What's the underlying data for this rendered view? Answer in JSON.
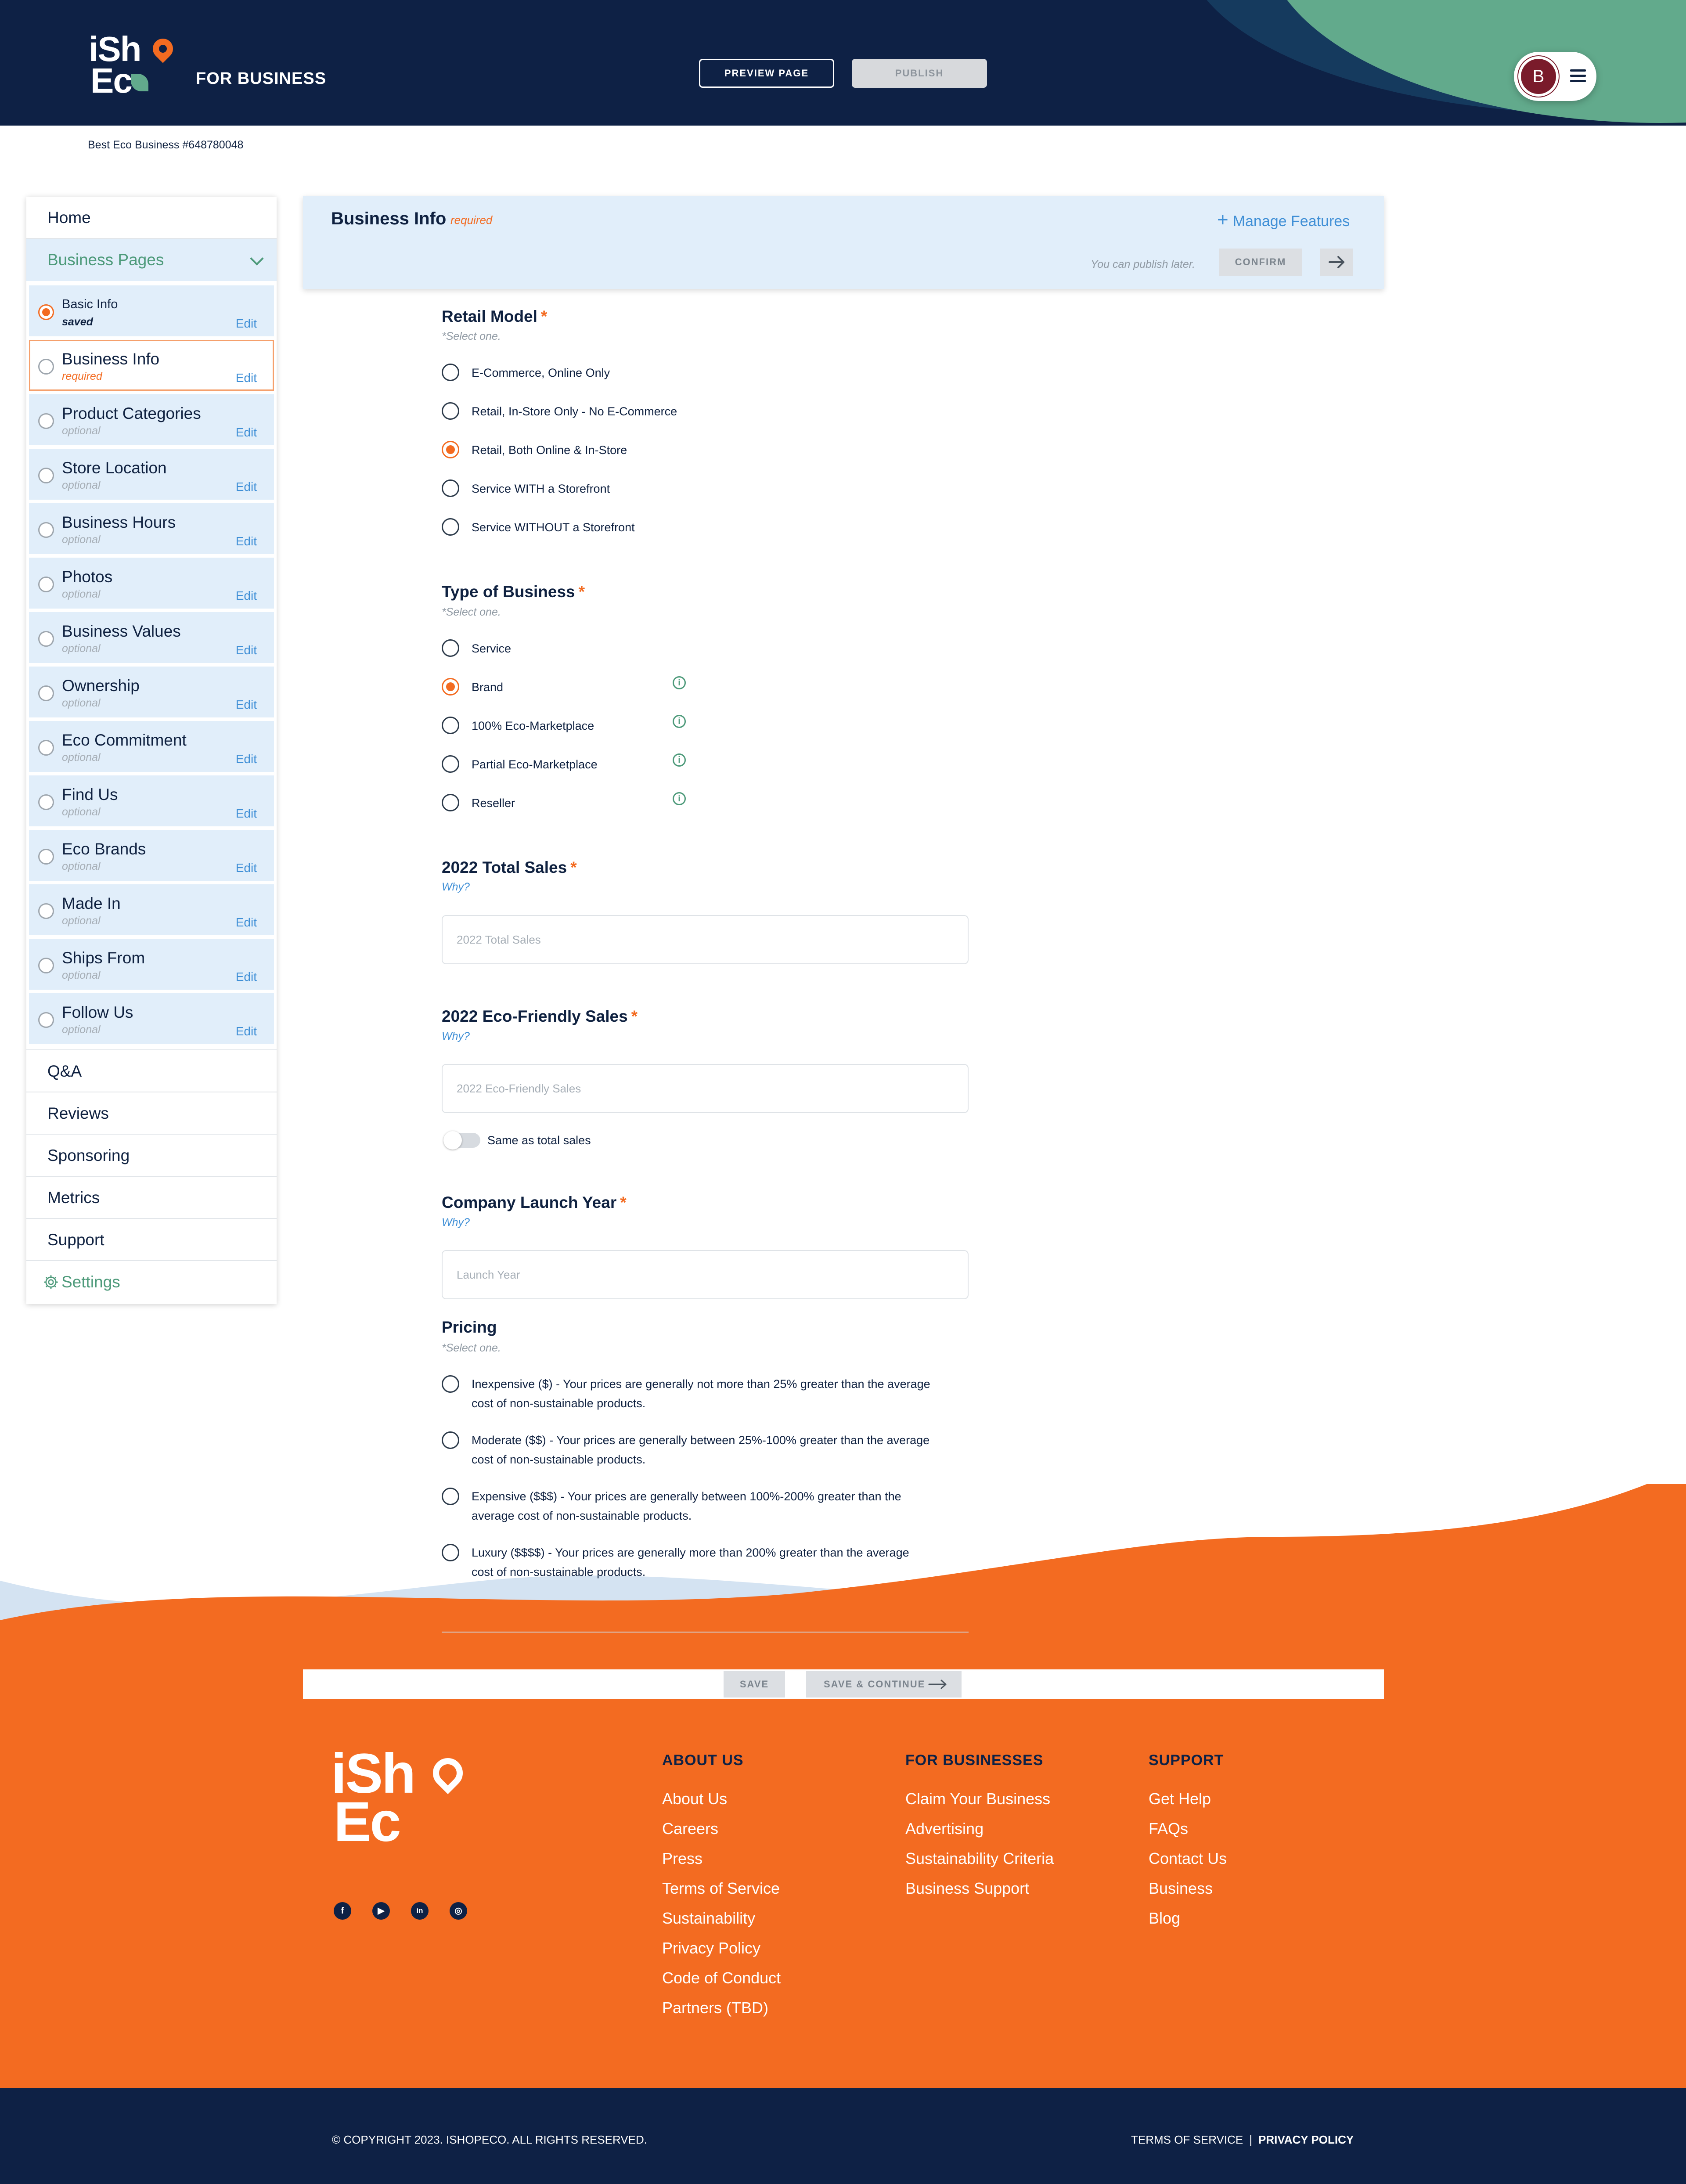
{
  "header": {
    "logo_top": "iSh",
    "logo_bottom": "Ec",
    "for_business": "FOR BUSINESS",
    "preview_label": "PREVIEW PAGE",
    "publish_label": "PUBLISH",
    "avatar_letter": "B"
  },
  "business_id": "Best Eco Business #648780048",
  "sidebar": {
    "home": "Home",
    "section": "Business Pages",
    "items": [
      {
        "label": "Basic Info",
        "status": "saved",
        "edit": "Edit"
      },
      {
        "label": "Business Info",
        "status": "required",
        "edit": "Edit"
      },
      {
        "label": "Product Categories",
        "status": "optional",
        "edit": "Edit"
      },
      {
        "label": "Store Location",
        "status": "optional",
        "edit": "Edit"
      },
      {
        "label": "Business Hours",
        "status": "optional",
        "edit": "Edit"
      },
      {
        "label": "Photos",
        "status": "optional",
        "edit": "Edit"
      },
      {
        "label": "Business Values",
        "status": "optional",
        "edit": "Edit"
      },
      {
        "label": "Ownership",
        "status": "optional",
        "edit": "Edit"
      },
      {
        "label": "Eco Commitment",
        "status": "optional",
        "edit": "Edit"
      },
      {
        "label": "Find Us",
        "status": "optional",
        "edit": "Edit"
      },
      {
        "label": "Eco Brands",
        "status": "optional",
        "edit": "Edit"
      },
      {
        "label": "Made In",
        "status": "optional",
        "edit": "Edit"
      },
      {
        "label": "Ships From",
        "status": "optional",
        "edit": "Edit"
      },
      {
        "label": "Follow Us",
        "status": "optional",
        "edit": "Edit"
      }
    ],
    "links": [
      "Q&A",
      "Reviews",
      "Sponsoring",
      "Metrics",
      "Support"
    ],
    "settings": "Settings"
  },
  "card": {
    "title": "Business Info",
    "required": "required",
    "manage": "Manage Features",
    "publish_later": "You can publish later.",
    "confirm": "CONFIRM"
  },
  "form": {
    "retail_model": {
      "label": "Retail Model",
      "hint": "*Select one.",
      "options": [
        "E-Commerce, Online Only",
        "Retail, In-Store Only - No E-Commerce",
        "Retail, Both Online & In-Store",
        "Service WITH a Storefront",
        "Service WITHOUT a Storefront"
      ],
      "selected": "Retail, Both Online & In-Store"
    },
    "business_type": {
      "label": "Type of Business",
      "hint": "*Select one.",
      "options": [
        "Service",
        "Brand",
        "100% Eco-Marketplace",
        "Partial Eco-Marketplace",
        "Reseller"
      ],
      "selected": "Brand"
    },
    "total_sales": {
      "label": "2022 Total Sales",
      "why": "Why?",
      "placeholder": "2022 Total Sales"
    },
    "eco_sales": {
      "label": "2022 Eco-Friendly Sales",
      "why": "Why?",
      "placeholder": "2022 Eco-Friendly Sales",
      "toggle_label": "Same as total sales",
      "toggle_on": false
    },
    "launch_year": {
      "label": "Company Launch Year",
      "why": "Why?",
      "placeholder": "Launch Year"
    },
    "pricing": {
      "label": "Pricing",
      "hint": "*Select one.",
      "options": [
        {
          "l1": "Inexpensive ($) - Your prices are generally not more than 25% greater than the average",
          "l2": "cost of non-sustainable products."
        },
        {
          "l1": "Moderate ($$) - Your prices are generally between 25%-100% greater than the average",
          "l2": "cost of non-sustainable products."
        },
        {
          "l1": "Expensive ($$$) - Your prices are generally between 100%-200% greater than the",
          "l2": "average cost of non-sustainable products."
        },
        {
          "l1": "Luxury ($$$$) - Your prices are generally more than 200% greater than the average",
          "l2": "cost of non-sustainable products."
        }
      ]
    },
    "asterisk": "*",
    "save": "SAVE",
    "save_continue": "SAVE & CONTINUE"
  },
  "footer": {
    "logo_top": "iSh",
    "logo_bottom": "Ec",
    "social": [
      "f",
      "▶",
      "in",
      "◎"
    ],
    "about": {
      "title": "ABOUT US",
      "links": [
        "About Us",
        "Careers",
        "Press",
        "Terms of Service",
        "Sustainability",
        "Privacy Policy",
        "Code of Conduct",
        "Partners (TBD)"
      ]
    },
    "business": {
      "title": "FOR BUSINESSES",
      "links": [
        "Claim Your Business",
        "Advertising",
        "Sustainability Criteria",
        "Business Support"
      ]
    },
    "support": {
      "title": "SUPPORT",
      "links": [
        "Get Help",
        "FAQs",
        "Contact Us",
        "Business",
        "Blog"
      ]
    },
    "copyright": "© COPYRIGHT 2023. ISHOPECO. ALL RIGHTS RESERVED.",
    "terms": "TERMS OF SERVICE",
    "separator": "|",
    "privacy": "PRIVACY POLICY"
  },
  "colors": {
    "navy": "#0e2145",
    "orange": "#f36b21",
    "green": "#62aa8c",
    "light_blue": "#e1eefa",
    "link_blue": "#3f8fd6"
  }
}
